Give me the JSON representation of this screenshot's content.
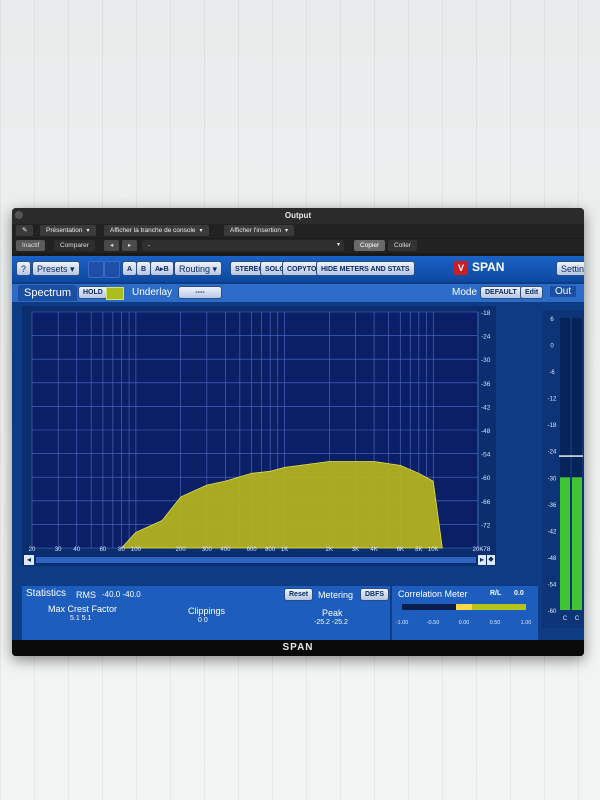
{
  "window": {
    "title": "Output"
  },
  "host_bar": {
    "presentation": "Présentation",
    "console_strip": "Afficher la tranche de console",
    "insertion": "Afficher l'insertion",
    "inactive": "Inactif",
    "compare": "Comparer",
    "preset_field": "-",
    "copy": "Copier",
    "paste": "Coller"
  },
  "toolbar": {
    "help": "?",
    "presets": "Presets",
    "a": "A",
    "b": "B",
    "a_to_b": "A▸B",
    "routing": "Routing",
    "stereo": "STEREO",
    "solo": "SOLO",
    "copy_to": "COPYTO",
    "hide_meters": "HIDE METERS AND STATS",
    "brand": "SPAN",
    "settings": "Settings"
  },
  "spectrum_bar": {
    "tab": "Spectrum",
    "hold": "HOLD",
    "underlay": "Underlay",
    "underlay_value": "----",
    "mode_label": "Mode",
    "mode_value": "DEFAULT",
    "edit": "Edit",
    "out_label": "Out"
  },
  "chart_data": {
    "type": "area",
    "x_ticks": [
      "20",
      "30",
      "40",
      "60",
      "80",
      "100",
      "200",
      "300",
      "400",
      "600",
      "800",
      "1K",
      "2K",
      "3K",
      "4K",
      "6K",
      "8K",
      "10K",
      "20K"
    ],
    "y_ticks": [
      "-18",
      "-24",
      "-30",
      "-36",
      "-42",
      "-48",
      "-54",
      "-60",
      "-66",
      "-72",
      "-78"
    ],
    "x_scale": "log",
    "ylim": [
      -78,
      -18
    ],
    "grid": true,
    "color": "#b7b51c",
    "spectrum": [
      [
        80,
        -78
      ],
      [
        100,
        -74
      ],
      [
        150,
        -71
      ],
      [
        200,
        -65
      ],
      [
        300,
        -62
      ],
      [
        400,
        -61
      ],
      [
        600,
        -59
      ],
      [
        800,
        -58.5
      ],
      [
        1000,
        -57.5
      ],
      [
        2000,
        -56
      ],
      [
        3000,
        -56
      ],
      [
        4000,
        -56
      ],
      [
        6000,
        -57
      ],
      [
        8000,
        -59
      ],
      [
        10000,
        -61
      ],
      [
        11500,
        -78
      ]
    ]
  },
  "out_meter": {
    "scale": [
      "6",
      "0",
      "-6",
      "-12",
      "-18",
      "-24",
      "-30",
      "-36",
      "-42",
      "-48",
      "-54",
      "-60"
    ],
    "ch_labels": [
      "C",
      "C"
    ],
    "level_db": -30,
    "peak_db": -25.2,
    "bar_color": "#3fc534"
  },
  "stats": {
    "tab": "Statistics",
    "rms_label": "RMS",
    "rms_values": "-40.0  -40.0",
    "crest_label": "Max Crest Factor",
    "crest_values": "5.1    5.1",
    "clippings_label": "Clippings",
    "clippings_values": "0    0",
    "reset": "Reset",
    "metering_label": "Metering",
    "metering_value": "DBFS",
    "peak_label": "Peak",
    "peak_values": "-25.2  -25.2"
  },
  "correlation": {
    "label": "Correlation Meter",
    "mode": "R/L",
    "value": "0.0",
    "scale": [
      "-1.00",
      "-0.50",
      "0.00",
      "0.50",
      "1.00"
    ]
  },
  "footer": {
    "brand": "SPAN"
  }
}
